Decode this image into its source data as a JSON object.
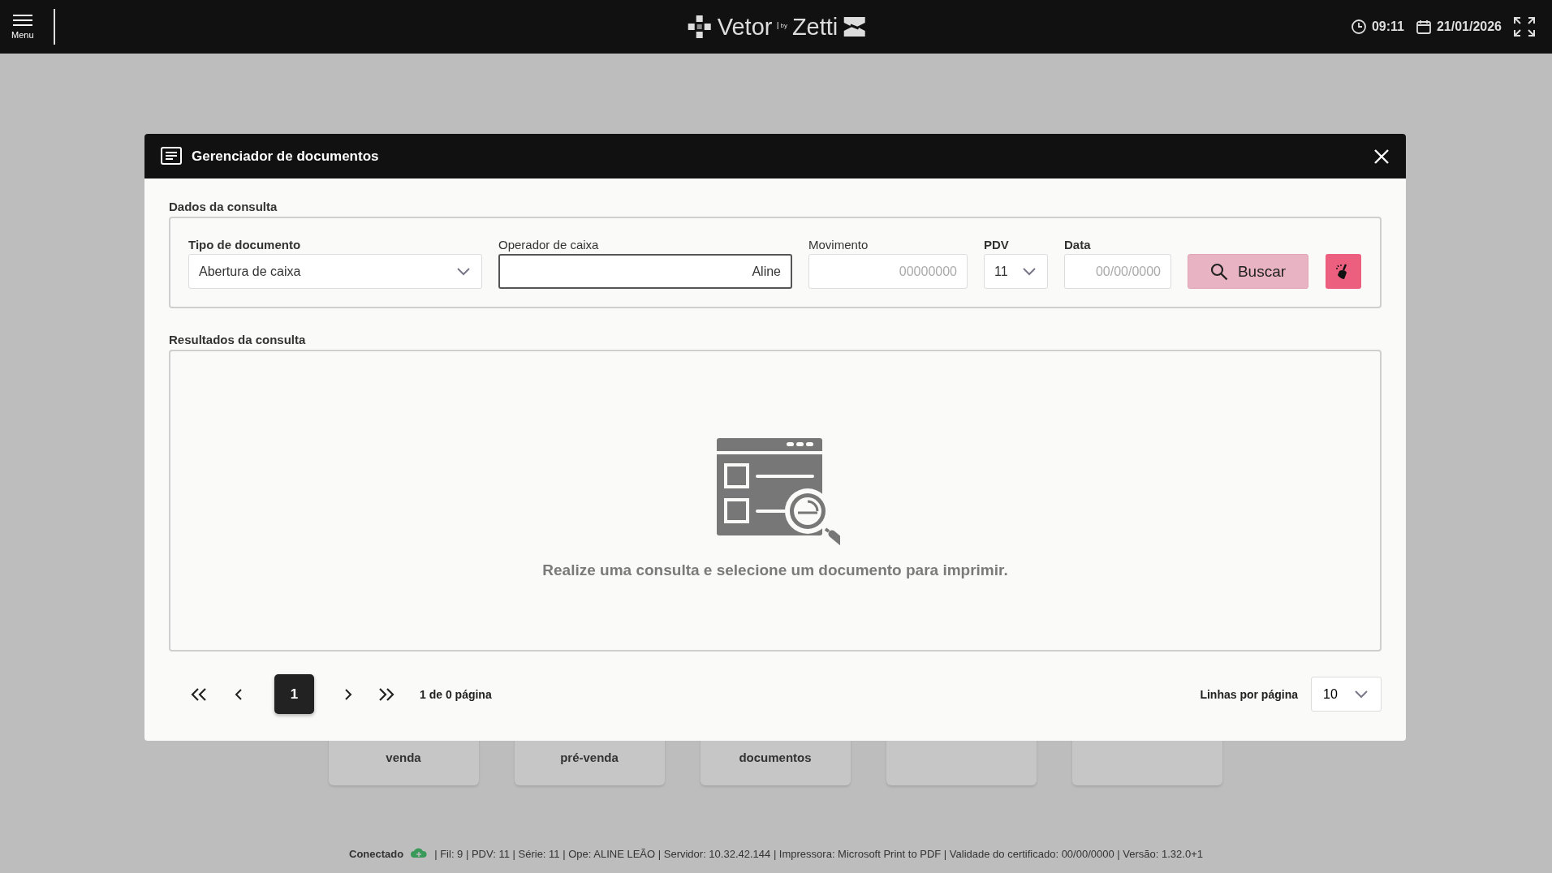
{
  "topbar": {
    "menu_label": "Menu",
    "brand": "Vetor",
    "brand_by": "by",
    "brand_partner": "Zetti",
    "time": "09:11",
    "date": "21/01/2026"
  },
  "background_cards": [
    {
      "kind": "labeled",
      "label": "venda"
    },
    {
      "kind": "labeled",
      "label": "pré-venda"
    },
    {
      "kind": "labeled",
      "label": "documentos"
    },
    {
      "kind": "covered"
    },
    {
      "kind": "covered"
    }
  ],
  "dialog": {
    "title": "Gerenciador de documentos",
    "query_section": {
      "title": "Dados da consulta",
      "fields": [
        {
          "kind": "select",
          "label": "Tipo de documento",
          "value": "Abertura de caixa"
        },
        {
          "kind": "input",
          "label": "Operador de caixa",
          "value": "Aline",
          "focused": true
        },
        {
          "kind": "input",
          "label": "Movimento",
          "placeholder": "00000000",
          "focused": false
        },
        {
          "kind": "select",
          "label": "PDV",
          "value": "11"
        },
        {
          "kind": "input",
          "label": "Data",
          "placeholder": "00/00/0000",
          "focused": false
        }
      ],
      "search_button": "Buscar"
    },
    "results_section": {
      "title": "Resultados da consulta",
      "empty_message": "Realize uma consulta e selecione um documento para imprimir."
    },
    "pagination": {
      "pages": [
        {
          "label": "1",
          "selected": true
        }
      ],
      "summary": "1 de 0 página",
      "rows_label": "Linhas por página",
      "rows_value": "10"
    }
  },
  "status_bar": {
    "connection": "Conectado",
    "details": "| Fil: 9 | PDV: 11 | Série: 11 | Ope: ALINE LEÃO | Servidor: 10.32.42.144 | Impressora: Microsoft Print to PDF | Validade do certificado: 00/00/0000 | Versão: 1.32.0+1"
  }
}
